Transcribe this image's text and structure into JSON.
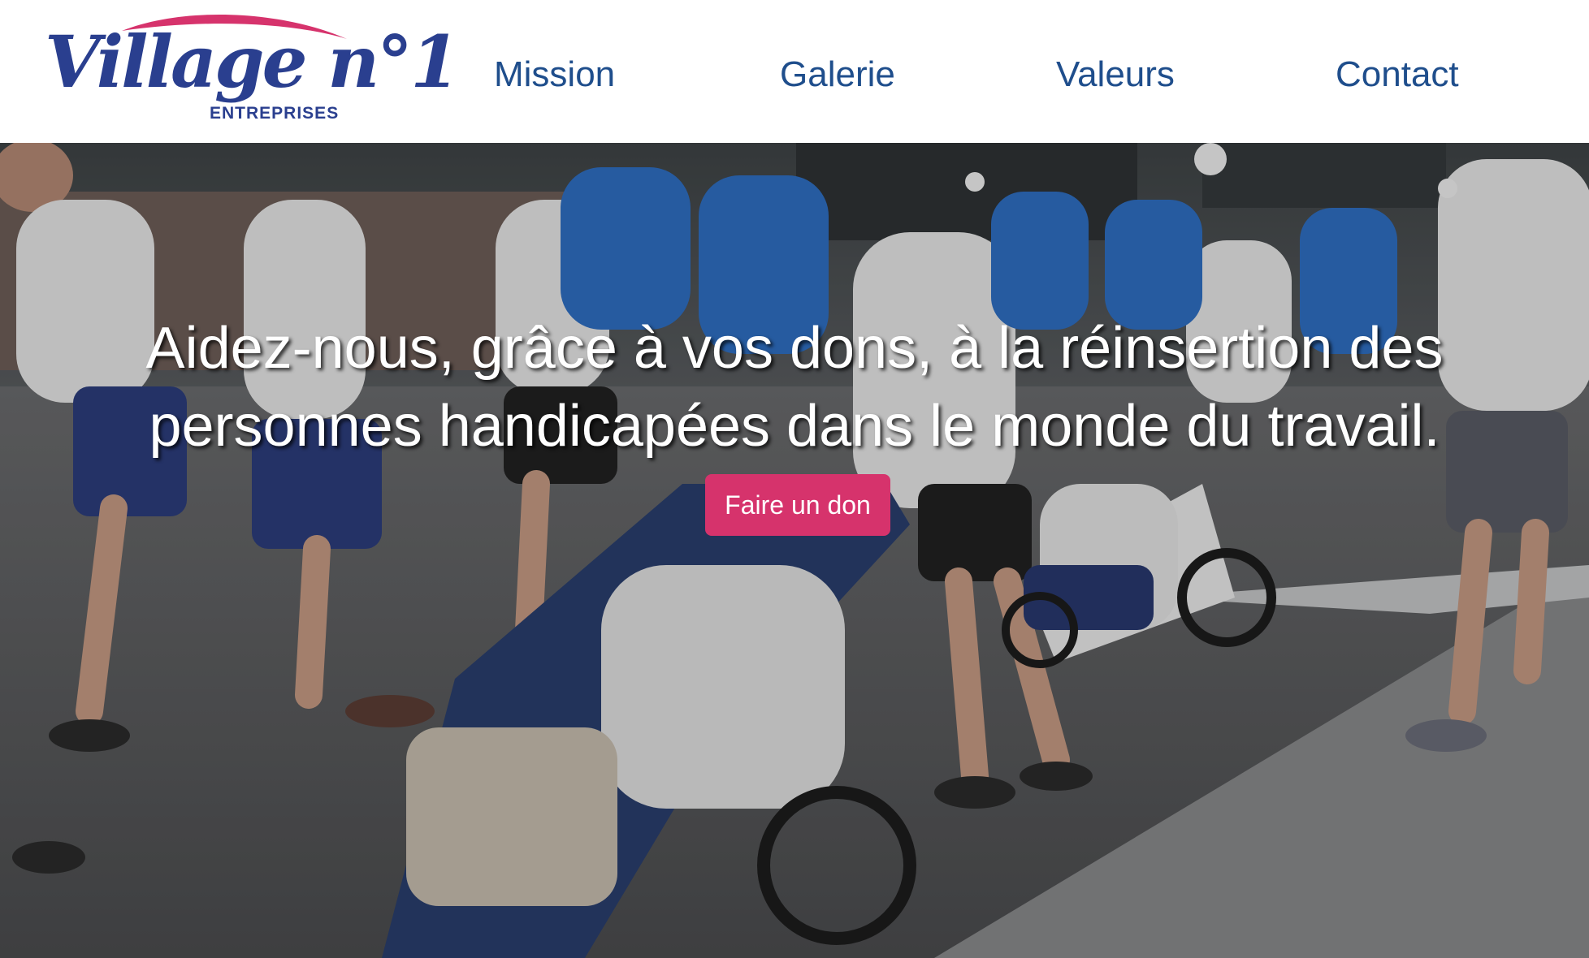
{
  "brand": {
    "logo_word": "Village n°1",
    "logo_sub": "ENTREPRISES",
    "primary_color": "#2a3f8f",
    "accent_color": "#d6336c"
  },
  "nav": {
    "items": [
      {
        "label": "Mission"
      },
      {
        "label": "Galerie"
      },
      {
        "label": "Valeurs"
      },
      {
        "label": "Contact"
      }
    ],
    "link_color": "#1f4e8c"
  },
  "hero": {
    "headline_line1": "Aidez-nous, grâce à vos dons, à la réinsertion des",
    "headline_line2": "personnes handicapées dans le monde du travail.",
    "cta_label": "Faire un don",
    "photo_description": "running-race-with-wheelchair-pushers"
  }
}
